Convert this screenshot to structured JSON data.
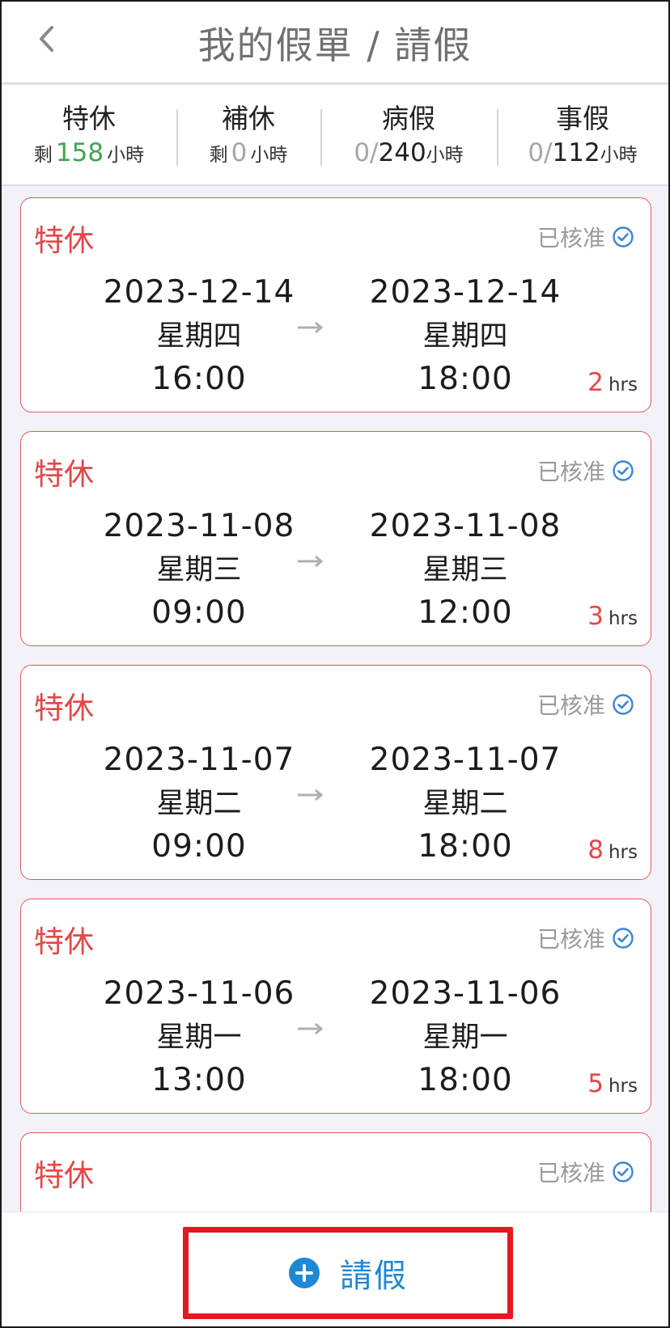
{
  "header": {
    "title": "我的假單 / 請假",
    "back_icon": "chevron-left-icon"
  },
  "summary": [
    {
      "type": "特休",
      "prefix": "剩",
      "value": "158",
      "unit": "小時"
    },
    {
      "type": "補休",
      "prefix": "剩",
      "value": "0",
      "unit": "小時"
    },
    {
      "type": "病假",
      "used": "0/",
      "total": "240",
      "unit": "小時"
    },
    {
      "type": "事假",
      "used": "0/",
      "total": "112",
      "unit": "小時"
    }
  ],
  "cards": [
    {
      "type": "特休",
      "status": "已核准",
      "from": {
        "date": "2023-12-14",
        "weekday": "星期四",
        "time": "16:00"
      },
      "to": {
        "date": "2023-12-14",
        "weekday": "星期四",
        "time": "18:00"
      },
      "hours": "2",
      "hours_unit": "hrs"
    },
    {
      "type": "特休",
      "status": "已核准",
      "from": {
        "date": "2023-11-08",
        "weekday": "星期三",
        "time": "09:00"
      },
      "to": {
        "date": "2023-11-08",
        "weekday": "星期三",
        "time": "12:00"
      },
      "hours": "3",
      "hours_unit": "hrs"
    },
    {
      "type": "特休",
      "status": "已核准",
      "from": {
        "date": "2023-11-07",
        "weekday": "星期二",
        "time": "09:00"
      },
      "to": {
        "date": "2023-11-07",
        "weekday": "星期二",
        "time": "18:00"
      },
      "hours": "8",
      "hours_unit": "hrs"
    },
    {
      "type": "特休",
      "status": "已核准",
      "from": {
        "date": "2023-11-06",
        "weekday": "星期一",
        "time": "13:00"
      },
      "to": {
        "date": "2023-11-06",
        "weekday": "星期一",
        "time": "18:00"
      },
      "hours": "5",
      "hours_unit": "hrs"
    },
    {
      "type": "特休",
      "status": "已核准"
    }
  ],
  "bottom": {
    "add_label": "請假",
    "add_icon": "plus-circle-icon"
  },
  "colors": {
    "accent_red": "#e24848",
    "green": "#3fa652",
    "blue": "#1e88d4",
    "highlight_red": "#e3191f"
  }
}
